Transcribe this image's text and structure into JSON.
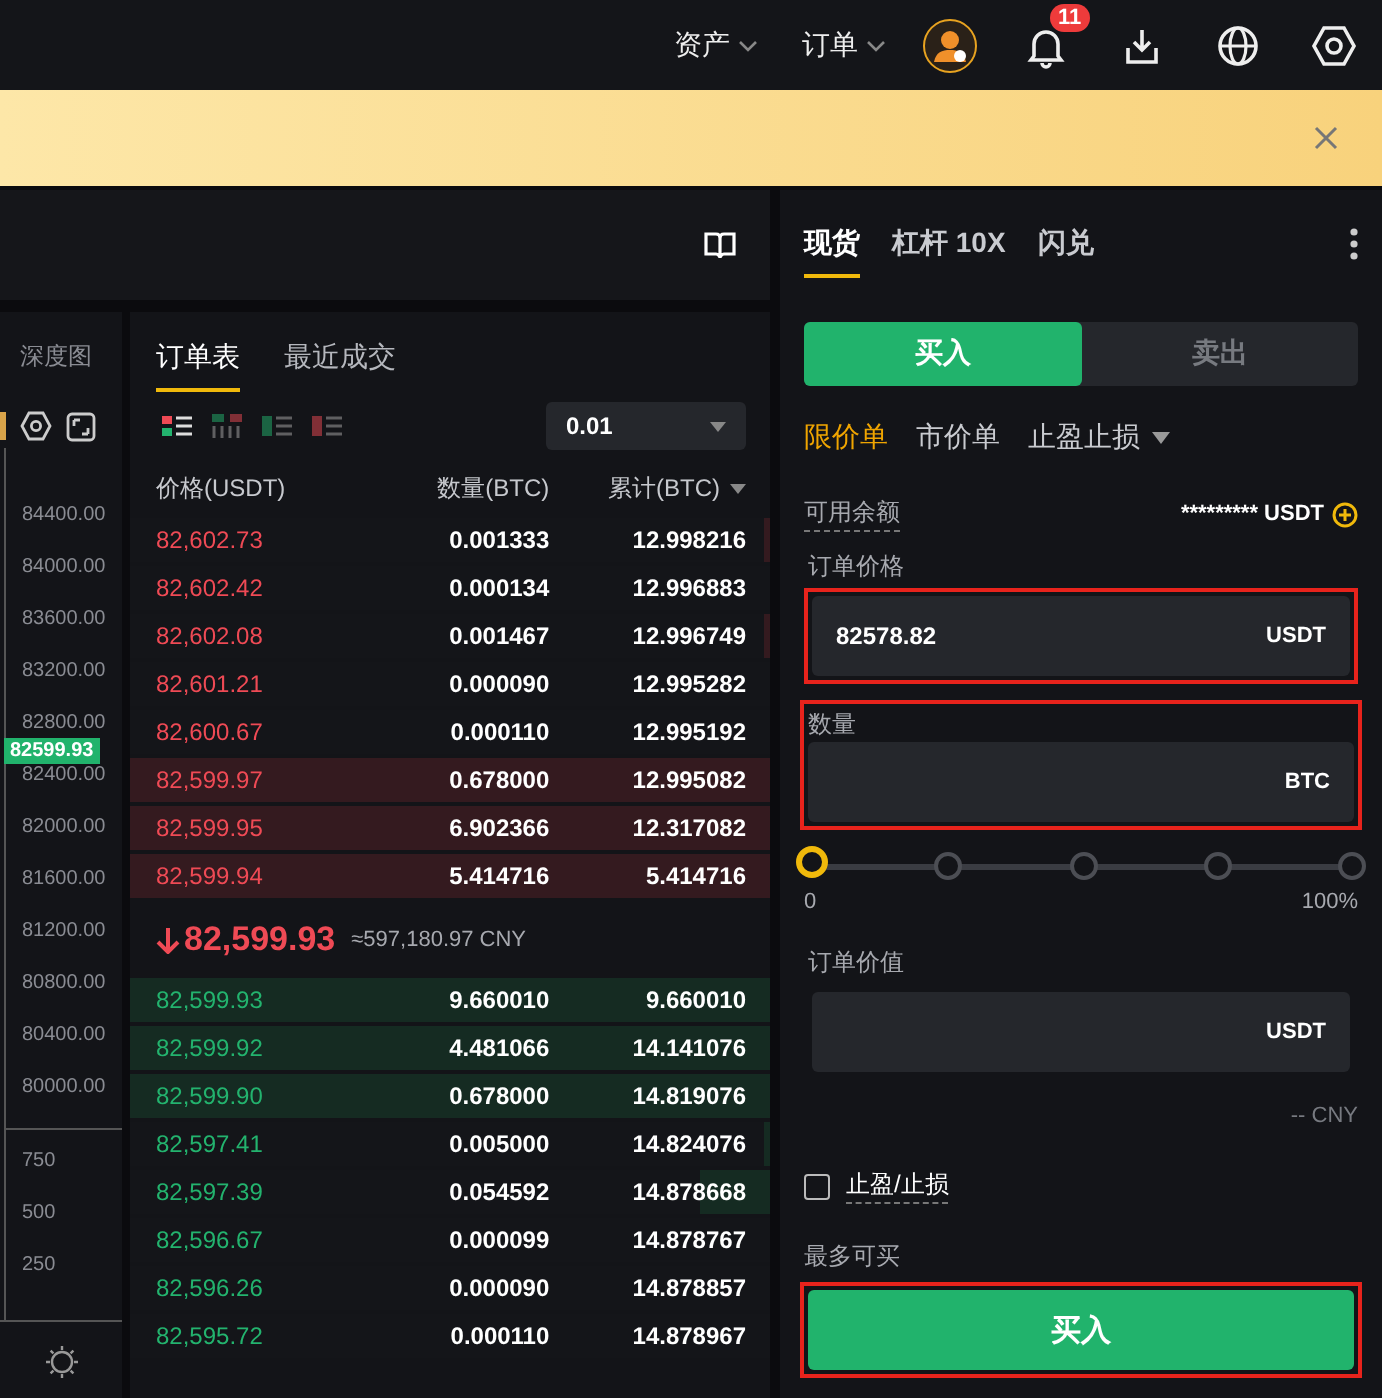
{
  "top_bar": {
    "menus": [
      {
        "label": "资产"
      },
      {
        "label": "订单"
      }
    ],
    "notification_count": "11"
  },
  "chart_panel": {
    "depth_tab": "深度图",
    "price_axis": [
      "84400.00",
      "84000.00",
      "83600.00",
      "83200.00",
      "82800.00",
      "82400.00",
      "82000.00",
      "81600.00",
      "81200.00",
      "80800.00",
      "80400.00",
      "80000.00"
    ],
    "current_price": "82599.93",
    "volume_axis": [
      "750",
      "500",
      "250"
    ]
  },
  "order_book": {
    "tabs": [
      {
        "label": "订单表",
        "selected": true
      },
      {
        "label": "最近成交",
        "selected": false
      }
    ],
    "layouts": [
      {
        "kind": "both",
        "selected": true
      },
      {
        "kind": "depth",
        "selected": false
      },
      {
        "kind": "bids",
        "selected": false
      },
      {
        "kind": "asks",
        "selected": false
      }
    ],
    "precision": "0.01",
    "columns": [
      "价格(USDT)",
      "数量(BTC)",
      "累计(BTC)"
    ],
    "asks": [
      {
        "price": "82,602.73",
        "amount": "0.001333",
        "total": "12.998216",
        "level": 0.01
      },
      {
        "price": "82,602.42",
        "amount": "0.000134",
        "total": "12.996883"
      },
      {
        "price": "82,602.08",
        "amount": "0.001467",
        "total": "12.996749",
        "level": 0.01
      },
      {
        "price": "82,601.21",
        "amount": "0.000090",
        "total": "12.995282"
      },
      {
        "price": "82,600.67",
        "amount": "0.000110",
        "total": "12.995192"
      },
      {
        "price": "82,599.97",
        "amount": "0.678000",
        "total": "12.995082",
        "level": 1
      },
      {
        "price": "82,599.95",
        "amount": "6.902366",
        "total": "12.317082",
        "level": 1
      },
      {
        "price": "82,599.94",
        "amount": "5.414716",
        "total": "5.414716",
        "level": 1
      }
    ],
    "last_price": {
      "price": "82,599.93",
      "falling": true,
      "cny": "≈597,180.97 CNY"
    },
    "bids": [
      {
        "price": "82,599.93",
        "amount": "9.660010",
        "total": "9.660010",
        "level": 1
      },
      {
        "price": "82,599.92",
        "amount": "4.481066",
        "total": "14.141076",
        "level": 1
      },
      {
        "price": "82,599.90",
        "amount": "0.678000",
        "total": "14.819076",
        "level": 1
      },
      {
        "price": "82,597.41",
        "amount": "0.005000",
        "total": "14.824076",
        "level": 0.01
      },
      {
        "price": "82,597.39",
        "amount": "0.054592",
        "total": "14.878668",
        "level": 0.11
      },
      {
        "price": "82,596.67",
        "amount": "0.000099",
        "total": "14.878767"
      },
      {
        "price": "82,596.26",
        "amount": "0.000090",
        "total": "14.878857"
      },
      {
        "price": "82,595.72",
        "amount": "0.000110",
        "total": "14.878967"
      }
    ]
  },
  "trade_panel": {
    "tabs": [
      {
        "label": "现货",
        "selected": true
      },
      {
        "label": "杠杆 10X",
        "selected": false
      },
      {
        "label": "闪兑",
        "selected": false
      }
    ],
    "sides": [
      {
        "label": "买入",
        "selected": true
      },
      {
        "label": "卖出",
        "selected": false
      }
    ],
    "order_types": [
      {
        "label": "限价单",
        "selected": true,
        "dropdown": false
      },
      {
        "label": "市价单",
        "selected": false,
        "dropdown": false
      },
      {
        "label": "止盈止损",
        "selected": false,
        "dropdown": true
      }
    ],
    "balance": {
      "label": "可用余额",
      "value": "********* USDT"
    },
    "price_field": {
      "label": "订单价格",
      "value": "82578.82",
      "unit": "USDT",
      "field_highlighted": true
    },
    "amount_field": {
      "label": "数量",
      "unit": "BTC",
      "group_highlighted": true
    },
    "slider": {
      "level": 0,
      "min_label": "0",
      "max_label": "100%"
    },
    "value_field": {
      "label": "订单价值",
      "unit": "USDT",
      "note": "-- CNY"
    },
    "tp_sl": {
      "label": "止盈/止损",
      "checked": false
    },
    "max_buy_label": "最多可买",
    "submit": {
      "label": "买入",
      "highlighted": true
    }
  }
}
